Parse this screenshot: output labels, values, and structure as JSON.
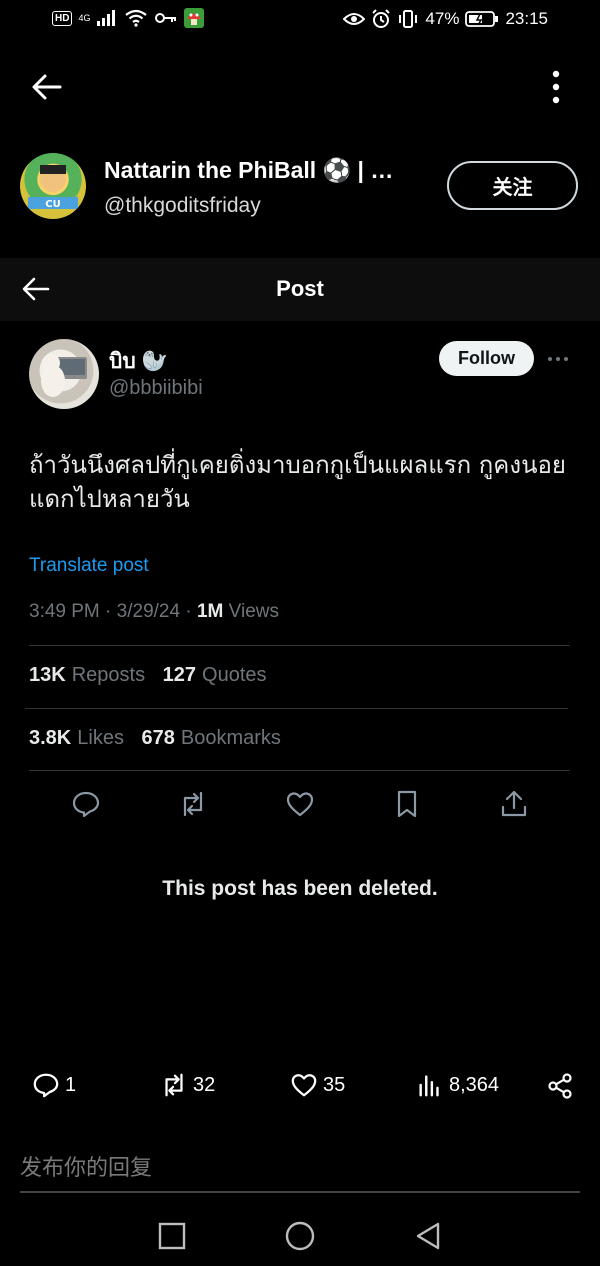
{
  "status_bar": {
    "hd": "HD",
    "net": "4G",
    "battery_pct": "47%",
    "time": "23:15"
  },
  "profile": {
    "name": "Nattarin the PhiBall ⚽ | …",
    "handle": "@thkgoditsfriday",
    "follow_label": "关注"
  },
  "embedded_header": {
    "title": "Post"
  },
  "post": {
    "author_name": "บิบ 🦭",
    "author_handle": "@bbbiibibi",
    "follow_label": "Follow",
    "text": "ถ้าวันนึงศลปที่กูเคยติ่งมาบอกกูเป็นแผลแรก กูคงนอยแดกไปหลายวัน",
    "translate_label": "Translate post",
    "time": "3:49 PM",
    "date": "3/29/24",
    "views_count": "1M",
    "views_label": "Views",
    "reposts_count": "13K",
    "reposts_label": "Reposts",
    "quotes_count": "127",
    "quotes_label": "Quotes",
    "likes_count": "3.8K",
    "likes_label": "Likes",
    "bookmarks_count": "678",
    "bookmarks_label": "Bookmarks",
    "sep": "·"
  },
  "deleted_notice": "This post has been deleted.",
  "bottom_actions": {
    "replies": "1",
    "reposts": "32",
    "likes": "35",
    "views": "8,364"
  },
  "reply_placeholder": "发布你的回复",
  "icons": [
    "back-arrow-icon",
    "more-vertical-icon",
    "more-horizontal-icon",
    "reply-icon",
    "repost-icon",
    "like-icon",
    "bookmark-icon",
    "share-icon",
    "views-icon",
    "share-nodes-icon",
    "nav-square-icon",
    "nav-circle-icon",
    "nav-back-triangle-icon"
  ]
}
